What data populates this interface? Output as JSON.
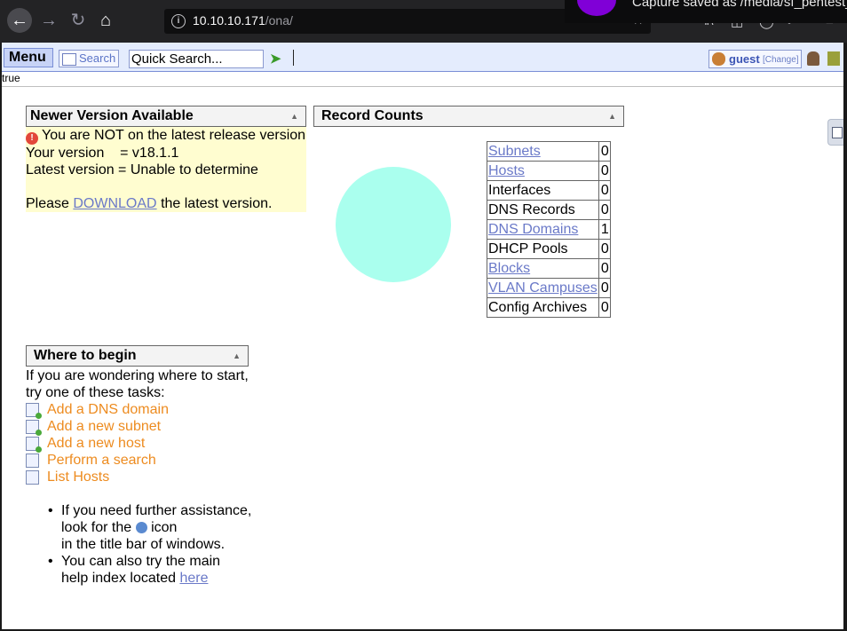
{
  "browser": {
    "url_host": "10.10.10.171",
    "url_path": "/ona/",
    "notification_text": "Capture saved as /media/sf_pentest_"
  },
  "menubar": {
    "menu_label": "Menu",
    "search_label": "Search",
    "quick_search_value": "Quick Search...",
    "user_name": "guest",
    "change_label": "[Change]",
    "true_text": "true"
  },
  "news": {
    "title": "Newer Version Available",
    "line1": "You are NOT on the latest release version",
    "your_version_label": "Your version",
    "your_version_value": "= v18.1.1",
    "latest_line": "Latest version = Unable to determine",
    "please_text": "Please",
    "download_link": "DOWNLOAD",
    "latest_suffix": "the latest version."
  },
  "record_counts": {
    "title": "Record Counts",
    "rows": [
      {
        "label": "Subnets",
        "count": "0",
        "link": true
      },
      {
        "label": "Hosts",
        "count": "0",
        "link": true
      },
      {
        "label": "Interfaces",
        "count": "0",
        "link": false
      },
      {
        "label": "DNS Records",
        "count": "0",
        "link": false
      },
      {
        "label": "DNS Domains",
        "count": "1",
        "link": true
      },
      {
        "label": "DHCP Pools",
        "count": "0",
        "link": false
      },
      {
        "label": "Blocks",
        "count": "0",
        "link": true
      },
      {
        "label": "VLAN Campuses",
        "count": "0",
        "link": true
      },
      {
        "label": "Config Archives",
        "count": "0",
        "link": false
      }
    ],
    "pie_color": "#aaffee"
  },
  "begin": {
    "title": "Where to begin",
    "intro_line1": "If you are wondering where to start,",
    "intro_line2": "try one of these tasks:",
    "tasks": [
      {
        "label": "Add a DNS domain",
        "icon": "add-document-icon"
      },
      {
        "label": "Add a new subnet",
        "icon": "add-document-icon"
      },
      {
        "label": "Add a new host",
        "icon": "add-document-icon"
      },
      {
        "label": "Perform a search",
        "icon": "search-form-icon"
      },
      {
        "label": "List Hosts",
        "icon": "list-icon"
      }
    ],
    "help1_line1": "If you need further assistance,",
    "help1_look": "look for the",
    "help1_icon_word": "icon",
    "help1_line3": "in the title bar of windows.",
    "help2_line1": "You can also try the main",
    "help2_prefix": "help index located",
    "help2_link": "here"
  }
}
